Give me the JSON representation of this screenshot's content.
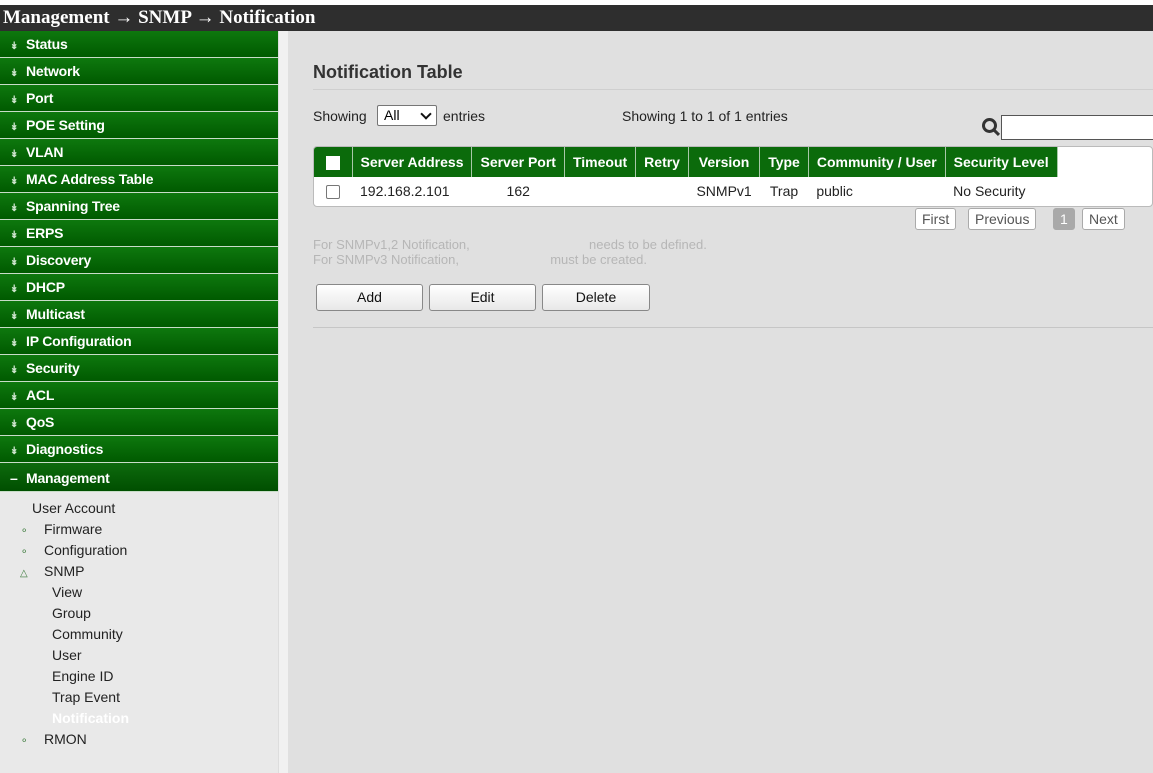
{
  "breadcrumb": {
    "level1": "Management",
    "level2": "SNMP",
    "level3": "Notification",
    "separator": "→"
  },
  "sidebar": {
    "collapsed_icon": "double-chevron-down-icon",
    "expanded_icon": "minus-icon",
    "items": [
      {
        "label": "Status"
      },
      {
        "label": "Network"
      },
      {
        "label": "Port"
      },
      {
        "label": "POE Setting"
      },
      {
        "label": "VLAN"
      },
      {
        "label": "MAC Address Table"
      },
      {
        "label": "Spanning Tree"
      },
      {
        "label": "ERPS"
      },
      {
        "label": "Discovery"
      },
      {
        "label": "DHCP"
      },
      {
        "label": "Multicast"
      },
      {
        "label": "IP Configuration"
      },
      {
        "label": "Security"
      },
      {
        "label": "ACL"
      },
      {
        "label": "QoS"
      },
      {
        "label": "Diagnostics"
      }
    ],
    "open_item": "Management",
    "sub_items": [
      {
        "label": "User Account"
      },
      {
        "label": "Firmware"
      },
      {
        "label": "Configuration"
      },
      {
        "label": "SNMP"
      },
      {
        "label": "View"
      },
      {
        "label": "Group"
      },
      {
        "label": "Community"
      },
      {
        "label": "User"
      },
      {
        "label": "Engine ID"
      },
      {
        "label": "Trap Event"
      },
      {
        "label": "Notification"
      },
      {
        "label": "RMON"
      }
    ]
  },
  "main": {
    "title": "Notification Table",
    "showing_label": "Showing",
    "entries_select": {
      "selected": "All"
    },
    "entries_label": "entries",
    "info": "Showing 1 to 1 of 1 entries",
    "search": {
      "value": ""
    },
    "table": {
      "columns": [
        "Server Address",
        "Server Port",
        "Timeout",
        "Retry",
        "Version",
        "Type",
        "Community / User",
        "Security Level"
      ],
      "rows": [
        {
          "server_address": "192.168.2.101",
          "server_port": "162",
          "timeout": "",
          "retry": "",
          "version": "SNMPv1",
          "type": "Trap",
          "community_user": "public",
          "security_level": "No Security"
        }
      ]
    },
    "pager": {
      "first": "First",
      "previous": "Previous",
      "current": "1",
      "next": "Next"
    },
    "note1": {
      "prefix": "For SNMPv1,2 Notification,",
      "suffix": "needs to be defined."
    },
    "note2": {
      "prefix": "For SNMPv3 Notification,",
      "suffix": "must be created."
    },
    "buttons": {
      "add": "Add",
      "edit": "Edit",
      "delete": "Delete"
    }
  },
  "colors": {
    "nav_green": "#0b6b0b",
    "titlebar": "#2e2e2e",
    "content_bg": "#e0e0e0",
    "sidebar_bg": "#e9e9e9"
  }
}
